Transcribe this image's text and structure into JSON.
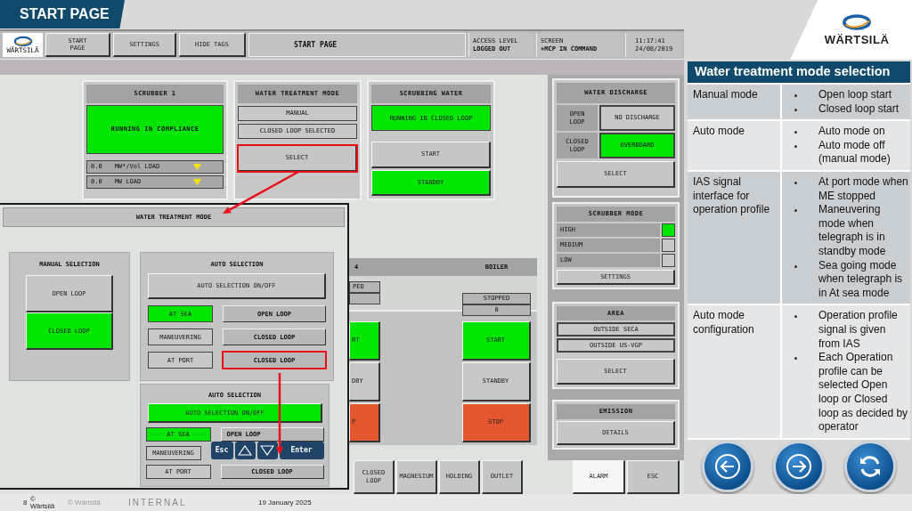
{
  "slide": {
    "title": "START PAGE",
    "brand": "WÄRTSILÄ"
  },
  "hmi": {
    "topbar": {
      "logo_text": "WÄRTSILÄ",
      "buttons": [
        "START PAGE",
        "SETTINGS",
        "HIDE TAGS"
      ],
      "title": "START PAGE",
      "access": {
        "label": "ACCESS LEVEL",
        "value": "LOGGED OUT"
      },
      "screen": {
        "label": "SCREEN",
        "value": "+MCP IN COMMAND"
      },
      "time": "11:17:41",
      "date": "24/08/2019"
    },
    "scrubber": {
      "title": "SCRUBBER 1",
      "status": "RUNNING IN COMPLIANCE",
      "loads": [
        {
          "value": "0.0",
          "label": "MW*/Vol LOAD"
        },
        {
          "value": "0.0",
          "label": "MW LOAD"
        }
      ]
    },
    "water_treatment_mode": {
      "title": "WATER TREATMENT MODE",
      "indicators": [
        "MANUAL",
        "CLOSED LOOP SELECTED"
      ],
      "select": {
        "label": "SELECT",
        "highlighted": true
      }
    },
    "scrubbing_water": {
      "title": "SCRUBBING WATER",
      "status": "RUNNING IN CLOSED LOOP",
      "buttons": [
        {
          "label": "START",
          "on": false
        },
        {
          "label": "STANDBY",
          "on": true
        }
      ]
    },
    "pump_panel": {
      "headers": [
        "4",
        "BOILER"
      ],
      "columns": [
        {
          "status": "PED",
          "buttons": [
            {
              "label": "RT",
              "kind": "start"
            },
            {
              "label": "DBY",
              "kind": "standby"
            },
            {
              "label": "P",
              "kind": "stop"
            }
          ]
        },
        {
          "status": "STOPPED",
          "value": "0",
          "buttons": [
            {
              "label": "START",
              "kind": "start"
            },
            {
              "label": "STANDBY",
              "kind": "standby"
            },
            {
              "label": "STOP",
              "kind": "stop"
            }
          ]
        }
      ]
    },
    "water_discharge": {
      "title": "WATER DISCHARGE",
      "rows": [
        {
          "label": "OPEN LOOP",
          "value": "NO DISCHARGE",
          "on": false
        },
        {
          "label": "CLOSED LOOP",
          "value": "OVERBOARD",
          "on": true
        }
      ],
      "button": "SELECT"
    },
    "scrubber_mode": {
      "title": "SCRUBBER MODE",
      "options": [
        {
          "label": "HIGH",
          "selected": true
        },
        {
          "label": "MEDIUM",
          "selected": false
        },
        {
          "label": "LOW",
          "selected": false
        }
      ],
      "button": "SETTINGS"
    },
    "area": {
      "title": "AREA",
      "indicators": [
        "OUTSIDE SECA",
        "OUTSIDE US-VGP"
      ],
      "button": "SELECT"
    },
    "emission": {
      "title": "EMISSION",
      "button": "DETAILS"
    },
    "bottom_buttons": [
      "CLOSED LOOP",
      "MAGNESIUM",
      "HOLDING",
      "OUTLET"
    ],
    "system_buttons": [
      {
        "label": "ALARM",
        "kind": "alarm"
      },
      {
        "label": "ESC",
        "kind": "plain"
      }
    ]
  },
  "popup": {
    "title": "WATER TREATMENT MODE",
    "manual": {
      "title": "MANUAL SELECTION",
      "buttons": [
        {
          "label": "OPEN LOOP",
          "on": false
        },
        {
          "label": "CLOSED LOOP",
          "on": true
        }
      ]
    },
    "auto": {
      "title": "AUTO SELECTION",
      "toggle": {
        "label": "AUTO SELECTION ON/OFF",
        "on": false
      },
      "profiles": [
        {
          "label": "AT SEA",
          "on": true,
          "mode": "OPEN LOOP",
          "highlighted": false
        },
        {
          "label": "MANEUVERING",
          "on": false,
          "mode": "CLOSED LOOP",
          "highlighted": false
        },
        {
          "label": "AT PORT",
          "on": false,
          "mode": "CLOSED LOOP",
          "highlighted": true
        }
      ]
    },
    "auto_edit": {
      "title": "AUTO SELECTION",
      "toggle": {
        "label": "AUTO SELECTION ON/OFF",
        "on": true
      },
      "profiles": [
        {
          "label": "AT SEA",
          "on": true,
          "mode": "OPEN LOOP"
        },
        {
          "label": "MANEUVERING",
          "on": false
        },
        {
          "label": "AT PORT",
          "on": false,
          "mode": "CLOSED LOOP"
        }
      ],
      "keys": [
        {
          "kind": "text",
          "label": "Esc"
        },
        {
          "kind": "up"
        },
        {
          "kind": "down"
        },
        {
          "kind": "text",
          "label": "Enter"
        }
      ]
    }
  },
  "info_panel": {
    "title": "Water treatment mode selection",
    "rows": [
      {
        "topic": "Manual mode",
        "points": [
          "Open loop start",
          "Closed loop start"
        ]
      },
      {
        "topic": "Auto mode",
        "points": [
          "Auto mode on",
          "Auto mode off (manual mode)"
        ]
      },
      {
        "topic": "IAS signal interface for operation profile",
        "points": [
          "At port mode when ME stopped",
          "Maneuvering mode when telegraph is in standby mode",
          "Sea going mode when telegraph is in At sea mode"
        ]
      },
      {
        "topic": "Auto mode configuration",
        "points": [
          "Operation profile signal is given from IAS",
          "Each Operation profile can be selected Open loop or Closed loop as decided by operator"
        ]
      }
    ]
  },
  "nav_buttons": [
    {
      "kind": "back"
    },
    {
      "kind": "forward"
    },
    {
      "kind": "refresh"
    }
  ],
  "footer": {
    "page": "8",
    "copyright": "© Wärtsilä",
    "owner": "© Wärtsilä",
    "classification": "INTERNAL",
    "date": "19 January 2025"
  }
}
